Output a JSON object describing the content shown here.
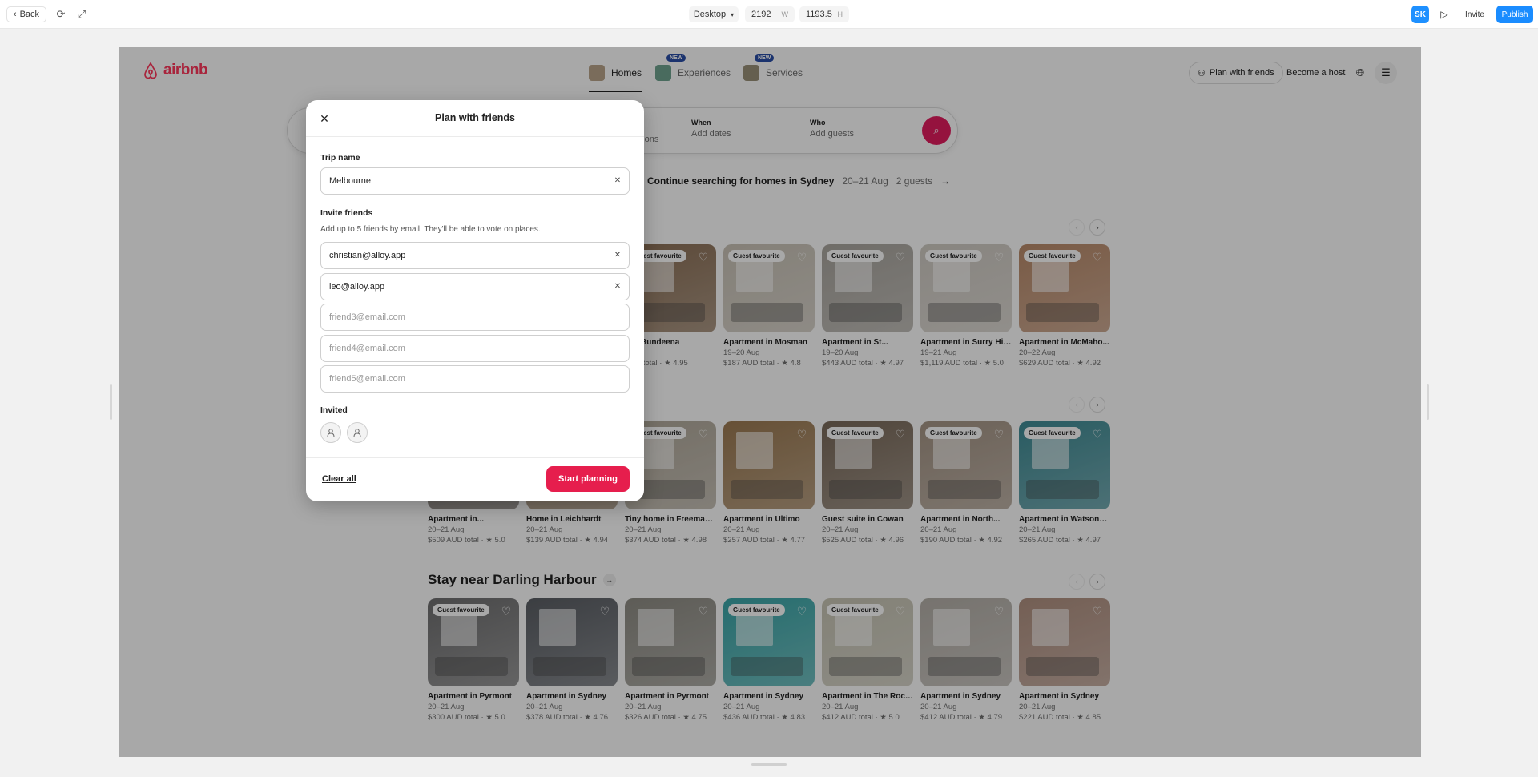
{
  "editor": {
    "back_label": "Back",
    "device": "Desktop",
    "width": "2192",
    "width_unit": "W",
    "height": "1193.5",
    "height_unit": "H",
    "user_initials": "SK",
    "invite_label": "Invite",
    "publish_label": "Publish"
  },
  "header": {
    "brand": "airbnb",
    "tabs": [
      {
        "label": "Homes",
        "badge": ""
      },
      {
        "label": "Experiences",
        "badge": "NEW"
      },
      {
        "label": "Services",
        "badge": "NEW"
      }
    ],
    "plan_with_friends": "Plan with friends",
    "become_host": "Become a host"
  },
  "search": {
    "where_value": "ations",
    "when_label": "When",
    "when_value": "Add dates",
    "who_label": "Who",
    "who_value": "Add guests"
  },
  "continue": {
    "text": "Continue searching for homes in Sydney",
    "dates": "20–21 Aug",
    "guests": "2 guests"
  },
  "section3_title": "Stay near Darling Harbour",
  "badge_label": "Guest favourite",
  "rows": [
    [
      {
        "title": "",
        "dates": "",
        "price": "",
        "rating": "",
        "badge": false,
        "color": "#8a7d70"
      },
      {
        "title": "",
        "dates": "",
        "price": "",
        "rating": "",
        "badge": false,
        "color": "#9a8f85"
      },
      {
        "title": "e in Bundeena",
        "dates": "0 Aug",
        "price": "AUD total",
        "rating": "★ 4.95",
        "badge": true,
        "color": "#8b6f55"
      },
      {
        "title": "Apartment in Mosman",
        "dates": "19–20 Aug",
        "price": "$187 AUD total",
        "rating": "★ 4.8",
        "badge": true,
        "color": "#c9c2b6"
      },
      {
        "title": "Apartment in St...",
        "dates": "19–20 Aug",
        "price": "$443 AUD total",
        "rating": "★ 4.97",
        "badge": true,
        "color": "#a9a59e"
      },
      {
        "title": "Apartment in Surry Hills",
        "dates": "19–21 Aug",
        "price": "$1,119 AUD total",
        "rating": "★ 5.0",
        "badge": true,
        "color": "#cfcac2"
      },
      {
        "title": "Apartment in McMaho...",
        "dates": "20–22 Aug",
        "price": "$629 AUD total",
        "rating": "★ 4.92",
        "badge": true,
        "color": "#b98a6a"
      }
    ],
    [
      {
        "title": "Apartment in...",
        "dates": "20–21 Aug",
        "price": "$509 AUD total",
        "rating": "★ 5.0",
        "badge": false,
        "color": "#7d7670"
      },
      {
        "title": "Home in Leichhardt",
        "dates": "20–21 Aug",
        "price": "$139 AUD total",
        "rating": "★ 4.94",
        "badge": false,
        "color": "#a08c74"
      },
      {
        "title": "Tiny home in Freemans...",
        "dates": "20–21 Aug",
        "price": "$374 AUD total",
        "rating": "★ 4.98",
        "badge": true,
        "color": "#b0a89a"
      },
      {
        "title": "Apartment in Ultimo",
        "dates": "20–21 Aug",
        "price": "$257 AUD total",
        "rating": "★ 4.77",
        "badge": false,
        "color": "#9c7a52"
      },
      {
        "title": "Guest suite in Cowan",
        "dates": "20–21 Aug",
        "price": "$525 AUD total",
        "rating": "★ 4.96",
        "badge": true,
        "color": "#7a6a5a"
      },
      {
        "title": "Apartment in North...",
        "dates": "20–21 Aug",
        "price": "$190 AUD total",
        "rating": "★ 4.92",
        "badge": true,
        "color": "#a59585"
      },
      {
        "title": "Apartment in Watsons...",
        "dates": "20–21 Aug",
        "price": "$265 AUD total",
        "rating": "★ 4.97",
        "badge": true,
        "color": "#3f8b95"
      }
    ],
    [
      {
        "title": "Apartment in Pyrmont",
        "dates": "20–21 Aug",
        "price": "$300 AUD total",
        "rating": "★ 5.0",
        "badge": true,
        "color": "#6f6f70"
      },
      {
        "title": "Apartment in Sydney",
        "dates": "20–21 Aug",
        "price": "$378 AUD total",
        "rating": "★ 4.76",
        "badge": false,
        "color": "#5a5e64"
      },
      {
        "title": "Apartment in Pyrmont",
        "dates": "20–21 Aug",
        "price": "$326 AUD total",
        "rating": "★ 4.75",
        "badge": false,
        "color": "#8e8c84"
      },
      {
        "title": "Apartment in Sydney",
        "dates": "20–21 Aug",
        "price": "$436 AUD total",
        "rating": "★ 4.83",
        "badge": true,
        "color": "#3aa6a8"
      },
      {
        "title": "Apartment in The Rocks",
        "dates": "20–21 Aug",
        "price": "$412 AUD total",
        "rating": "★ 5.0",
        "badge": true,
        "color": "#c7c4b4"
      },
      {
        "title": "Apartment in Sydney",
        "dates": "20–21 Aug",
        "price": "$412 AUD total",
        "rating": "★ 4.79",
        "badge": false,
        "color": "#b4afa8"
      },
      {
        "title": "Apartment in Sydney",
        "dates": "20–21 Aug",
        "price": "$221 AUD total",
        "rating": "★ 4.85",
        "badge": false,
        "color": "#b09080"
      }
    ]
  ],
  "modal": {
    "title": "Plan with friends",
    "trip_label": "Trip name",
    "trip_value": "Melbourne",
    "invite_label": "Invite friends",
    "invite_sub": "Add up to 5 friends by email. They'll be able to vote on places.",
    "emails": [
      {
        "value": "christian@alloy.app",
        "placeholder": ""
      },
      {
        "value": "leo@alloy.app",
        "placeholder": ""
      },
      {
        "value": "",
        "placeholder": "friend3@email.com"
      },
      {
        "value": "",
        "placeholder": "friend4@email.com"
      },
      {
        "value": "",
        "placeholder": "friend5@email.com"
      }
    ],
    "invited_label": "Invited",
    "clear_all": "Clear all",
    "start_label": "Start planning"
  }
}
